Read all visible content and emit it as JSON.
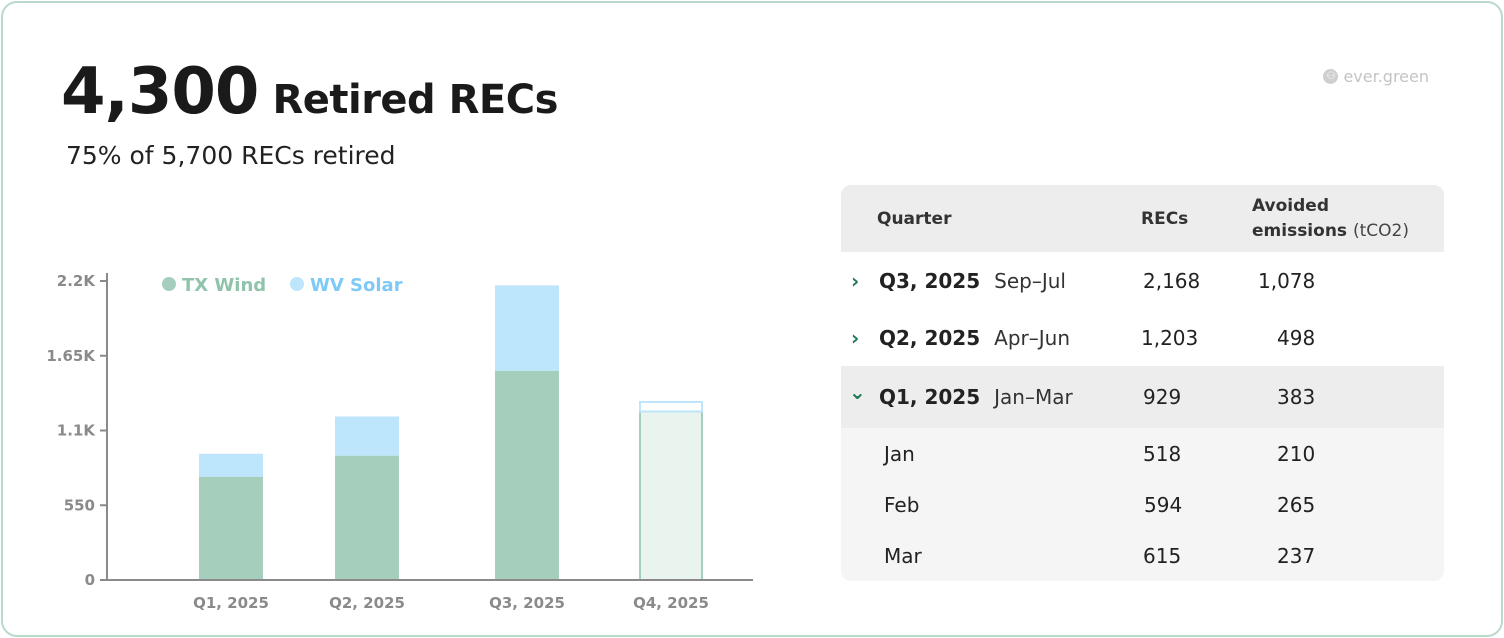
{
  "header": {
    "total_number": "4,300",
    "total_label": "Retired RECs",
    "subline": "75% of 5,700 RECs retired"
  },
  "brand": {
    "logo_glyph": "⚇",
    "name": "ever.green"
  },
  "chart_data": {
    "type": "bar",
    "stacked": true,
    "categories": [
      "Q1, 2025",
      "Q2, 2025",
      "Q3, 2025",
      "Q4, 2025"
    ],
    "series": [
      {
        "name": "TX Wind",
        "color": "#a5cebd",
        "values": [
          760,
          915,
          1540,
          1240
        ]
      },
      {
        "name": "WV Solar",
        "color": "#bde5fc",
        "values": [
          169,
          288,
          628,
          70
        ]
      }
    ],
    "projected_categories": [
      "Q4, 2025"
    ],
    "ylim": [
      0,
      2200
    ],
    "yticks": [
      0,
      550,
      1100,
      1650,
      2200
    ],
    "ytick_labels": [
      "0",
      "550",
      "1.1K",
      "1.65K",
      "2.2K"
    ],
    "legend_position": "top-left"
  },
  "table": {
    "headers": {
      "quarter": "Quarter",
      "recs": "RECs",
      "avoided": "Avoided",
      "emissions": "emissions",
      "unit": "(tCO2)"
    },
    "rows": [
      {
        "chevron": "›",
        "quarter": "Q3, 2025",
        "range": "Sep–Jul",
        "recs": "2,168",
        "avoided": "1,078"
      },
      {
        "chevron": "›",
        "quarter": "Q2, 2025",
        "range": "Apr–Jun",
        "recs": "1,203",
        "avoided": "498"
      },
      {
        "chevron": "⌄",
        "quarter": "Q1, 2025",
        "range": "Jan–Mar",
        "recs": "929",
        "avoided": "383"
      }
    ],
    "subrows": [
      {
        "month": "Jan",
        "recs": "518",
        "avoided": "210"
      },
      {
        "month": "Feb",
        "recs": "594",
        "avoided": "265"
      },
      {
        "month": "Mar",
        "recs": "615",
        "avoided": "237"
      }
    ]
  }
}
